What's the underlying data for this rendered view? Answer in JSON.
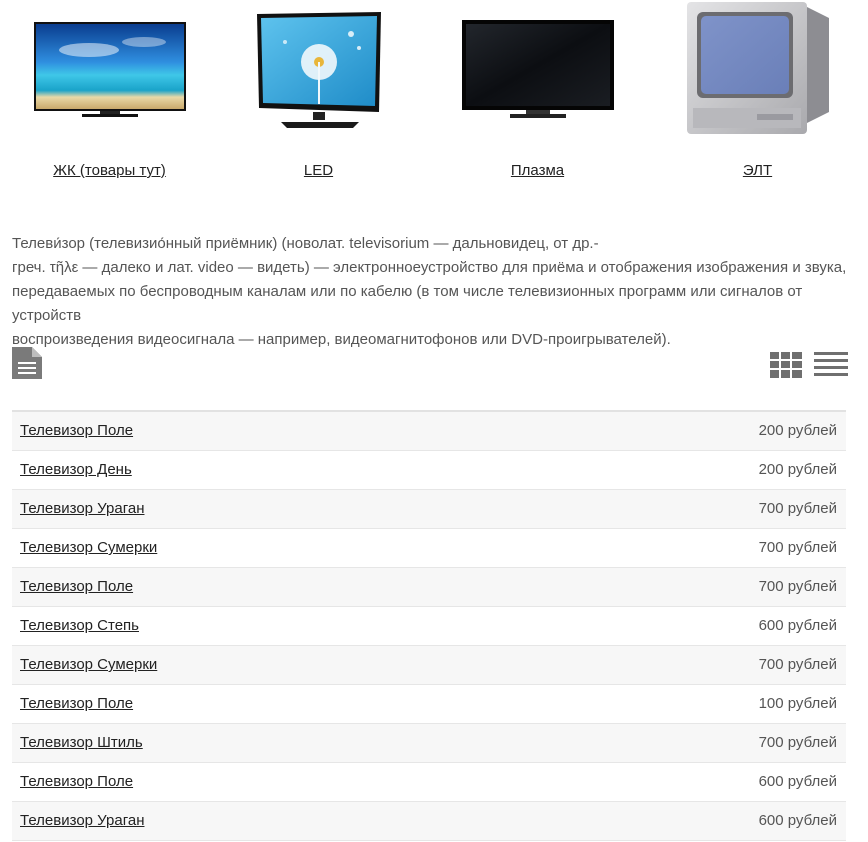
{
  "categories": [
    {
      "label": "ЖК (товары тут)",
      "icon": "lcd-tv-image"
    },
    {
      "label": "LED",
      "icon": "led-tv-image"
    },
    {
      "label": "Плазма",
      "icon": "plasma-tv-image"
    },
    {
      "label": "ЭЛТ",
      "icon": "crt-tv-image"
    }
  ],
  "description": {
    "line1": "Телеви́зор (телевизио́нный приёмник) (новолат. televisorium — дальновидец, от др.-",
    "line2": "греч. τῆλε — далеко и лат. video — видеть) — электронноеустройство для приёма и отображения изображения и звука,",
    "line3": "передаваемых по беспроводным каналам или по кабелю (в том числе телевизионных программ или сигналов от устройств",
    "line4": "воспроизведения видеосигнала — например, видеомагнитофонов или DVD-проигрывателей)."
  },
  "toolbar": {
    "doc_icon": "document-icon",
    "grid_icon": "grid-view-icon",
    "list_icon": "list-view-icon"
  },
  "products": [
    {
      "name": "Телевизор Поле",
      "price": "200 рублей"
    },
    {
      "name": "Телевизор День",
      "price": "200 рублей"
    },
    {
      "name": "Телевизор Ураган",
      "price": "700 рублей"
    },
    {
      "name": "Телевизор Сумерки",
      "price": "700 рублей"
    },
    {
      "name": "Телевизор Поле",
      "price": "700 рублей"
    },
    {
      "name": "Телевизор Степь",
      "price": "600 рублей"
    },
    {
      "name": "Телевизор Сумерки",
      "price": "700 рублей"
    },
    {
      "name": "Телевизор Поле",
      "price": "100 рублей"
    },
    {
      "name": "Телевизор Штиль",
      "price": "700 рублей"
    },
    {
      "name": "Телевизор Поле",
      "price": "600 рублей"
    },
    {
      "name": "Телевизор Ураган",
      "price": "600 рублей"
    }
  ]
}
